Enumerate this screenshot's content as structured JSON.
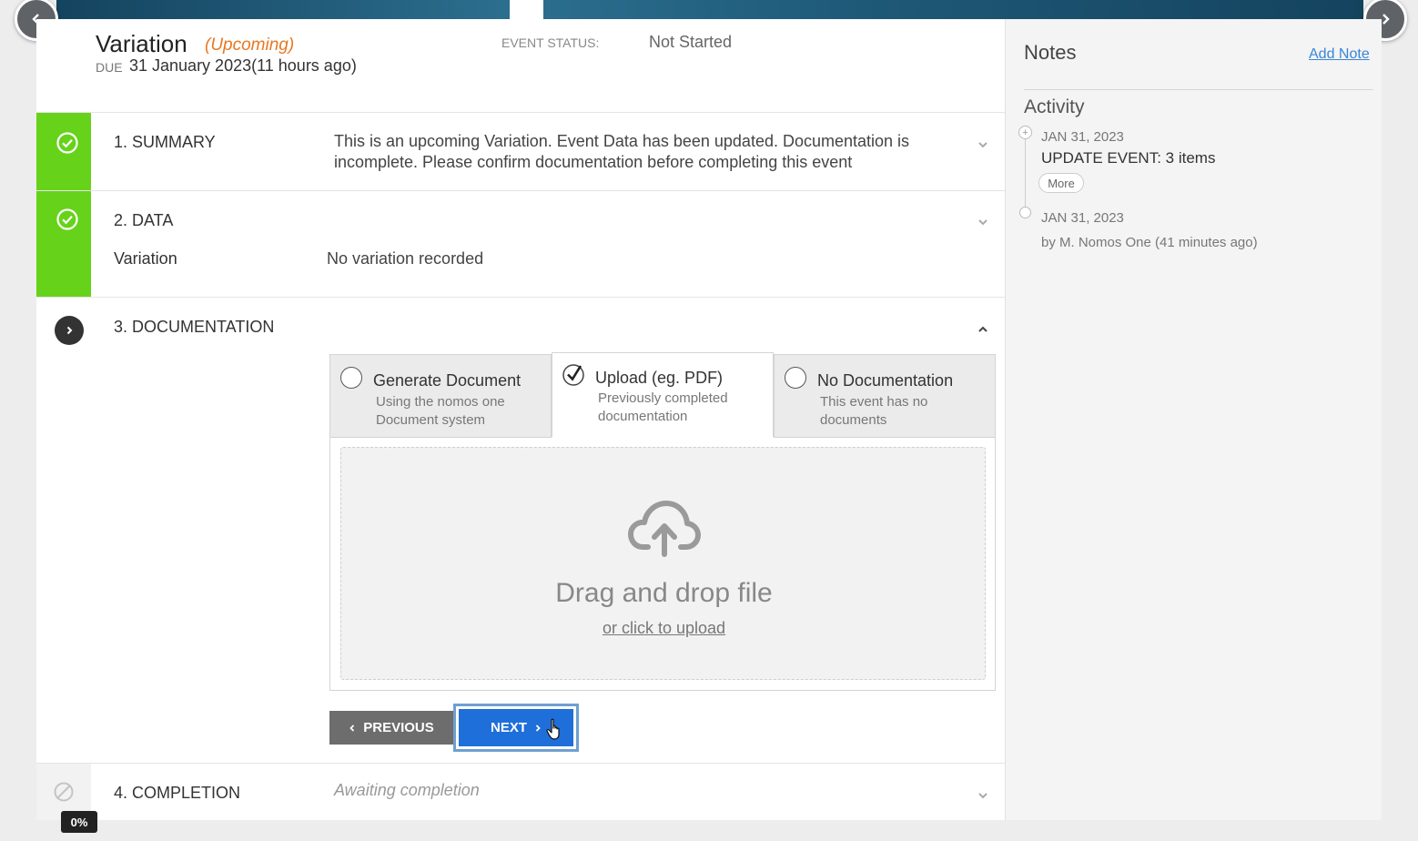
{
  "header": {
    "title": "Variation",
    "upcoming": "(Upcoming)",
    "due_label": "DUE",
    "due_date": "31 January 2023(11 hours ago)",
    "status_label": "EVENT STATUS:",
    "status_value": "Not Started"
  },
  "sections": {
    "summary": {
      "title": "1. SUMMARY",
      "text": "This is an upcoming Variation. Event Data has been updated. Documentation is incomplete. Please confirm documentation before completing this event"
    },
    "data": {
      "title": "2. DATA",
      "label": "Variation",
      "value": "No variation recorded"
    },
    "documentation": {
      "title": "3. DOCUMENTATION",
      "tabs": [
        {
          "title": "Generate Document",
          "sub": "Using the nomos one Document system"
        },
        {
          "title": "Upload (eg. PDF)",
          "sub": "Previously completed documentation"
        },
        {
          "title": "No Documentation",
          "sub": "This event has no documents"
        }
      ],
      "drop_title": "Drag and drop file",
      "drop_link": "or click to upload",
      "prev_label": "PREVIOUS",
      "next_label": "NEXT"
    },
    "completion": {
      "title": "4. COMPLETION",
      "sub": "Awaiting completion"
    }
  },
  "progress": "0%",
  "sidebar": {
    "notes_title": "Notes",
    "add_note": "Add Note",
    "activity_title": "Activity",
    "activities": [
      {
        "date": "JAN 31, 2023",
        "event": "UPDATE EVENT: 3 items",
        "more": "More"
      },
      {
        "date": "JAN 31, 2023",
        "by": "by M. Nomos One (41 minutes ago)"
      }
    ]
  },
  "colors": {
    "complete": "#66d31a",
    "primary": "#1e6fd9",
    "upcoming": "#e87722",
    "link": "#3a86d6"
  }
}
